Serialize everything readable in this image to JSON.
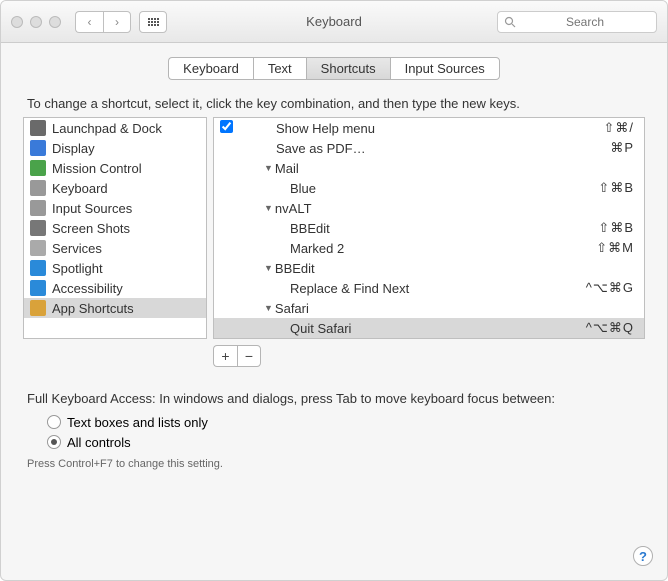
{
  "window": {
    "title": "Keyboard"
  },
  "search": {
    "placeholder": "Search"
  },
  "tabs": [
    {
      "label": "Keyboard"
    },
    {
      "label": "Text"
    },
    {
      "label": "Shortcuts"
    },
    {
      "label": "Input Sources"
    }
  ],
  "instruction": "To change a shortcut, select it, click the key combination, and then type the new keys.",
  "categories": [
    {
      "label": "Launchpad & Dock",
      "iconColor": "#6a6a6a"
    },
    {
      "label": "Display",
      "iconColor": "#3a7ad9"
    },
    {
      "label": "Mission Control",
      "iconColor": "#4aa34a"
    },
    {
      "label": "Keyboard",
      "iconColor": "#999"
    },
    {
      "label": "Input Sources",
      "iconColor": "#999"
    },
    {
      "label": "Screen Shots",
      "iconColor": "#777"
    },
    {
      "label": "Services",
      "iconColor": "#aaa"
    },
    {
      "label": "Spotlight",
      "iconColor": "#2a8ad9"
    },
    {
      "label": "Accessibility",
      "iconColor": "#2a8ad9"
    },
    {
      "label": "App Shortcuts",
      "iconColor": "#d9a23a"
    }
  ],
  "shortcuts": {
    "top": [
      {
        "label": "Show Help menu",
        "keys": "⇧⌘/",
        "checked": true
      },
      {
        "label": "Save as PDF…",
        "keys": "⌘P"
      }
    ],
    "groups": [
      {
        "name": "Mail",
        "items": [
          {
            "label": "Blue",
            "keys": "⇧⌘B"
          }
        ]
      },
      {
        "name": "nvALT",
        "items": [
          {
            "label": "BBEdit",
            "keys": "⇧⌘B"
          },
          {
            "label": "Marked 2",
            "keys": "⇧⌘M"
          }
        ]
      },
      {
        "name": "BBEdit",
        "items": [
          {
            "label": "Replace & Find Next",
            "keys": "^⌥⌘G"
          }
        ]
      },
      {
        "name": "Safari",
        "items": [
          {
            "label": "Quit Safari",
            "keys": "^⌥⌘Q",
            "selected": true
          }
        ]
      }
    ]
  },
  "buttons": {
    "add": "+",
    "remove": "−"
  },
  "fka": {
    "label": "Full Keyboard Access: In windows and dialogs, press Tab to move keyboard focus between:",
    "opt1": "Text boxes and lists only",
    "opt2": "All controls",
    "hint": "Press Control+F7 to change this setting."
  },
  "help": "?"
}
